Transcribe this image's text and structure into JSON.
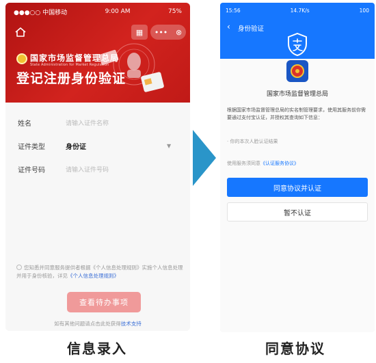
{
  "left_screen": {
    "status": {
      "carrier": "●●●○○ 中国移动",
      "time": "9:00 AM",
      "battery": "75%"
    },
    "header": {
      "org_name": "国家市场监督管理总局",
      "org_name_en": "State Administration for Market Regulation",
      "title": "登记注册身份验证"
    },
    "form": {
      "fields": [
        {
          "label": "姓名",
          "value": "请输入证件名称"
        },
        {
          "label": "证件类型",
          "value": "身份证"
        },
        {
          "label": "证件号码",
          "value": "请输入证件号码"
        }
      ],
      "consent_prefix": "您知悉并同意服务提供者根据《个人信息处理规则》实施个人信息处理并用于身份核验，详见",
      "consent_link": "《个人信息处理规则》",
      "submit_label": "查看待办事项",
      "help_prefix": "如有其他问题请点击此处获得",
      "help_link": "技术支持"
    },
    "caption": "信息录入"
  },
  "right_screen": {
    "status": {
      "time": "15:56",
      "network": "14.7K/s",
      "battery": "100"
    },
    "nav_title": "身份验证",
    "org_name": "国家市场监督管理总局",
    "description": "根据国家市场监督管理总局的实名制管理要求，使用其服务前你需要通过支付宝认证，并授权其查询如下信息：",
    "bullet": "· 你的本次人脸认证结果",
    "agreement_prefix": "使用服务须同意",
    "agreement_link": "《认证服务协议》",
    "agree_button": "同意协议并认证",
    "decline_button": "暂不认证",
    "caption": "同意协议"
  }
}
